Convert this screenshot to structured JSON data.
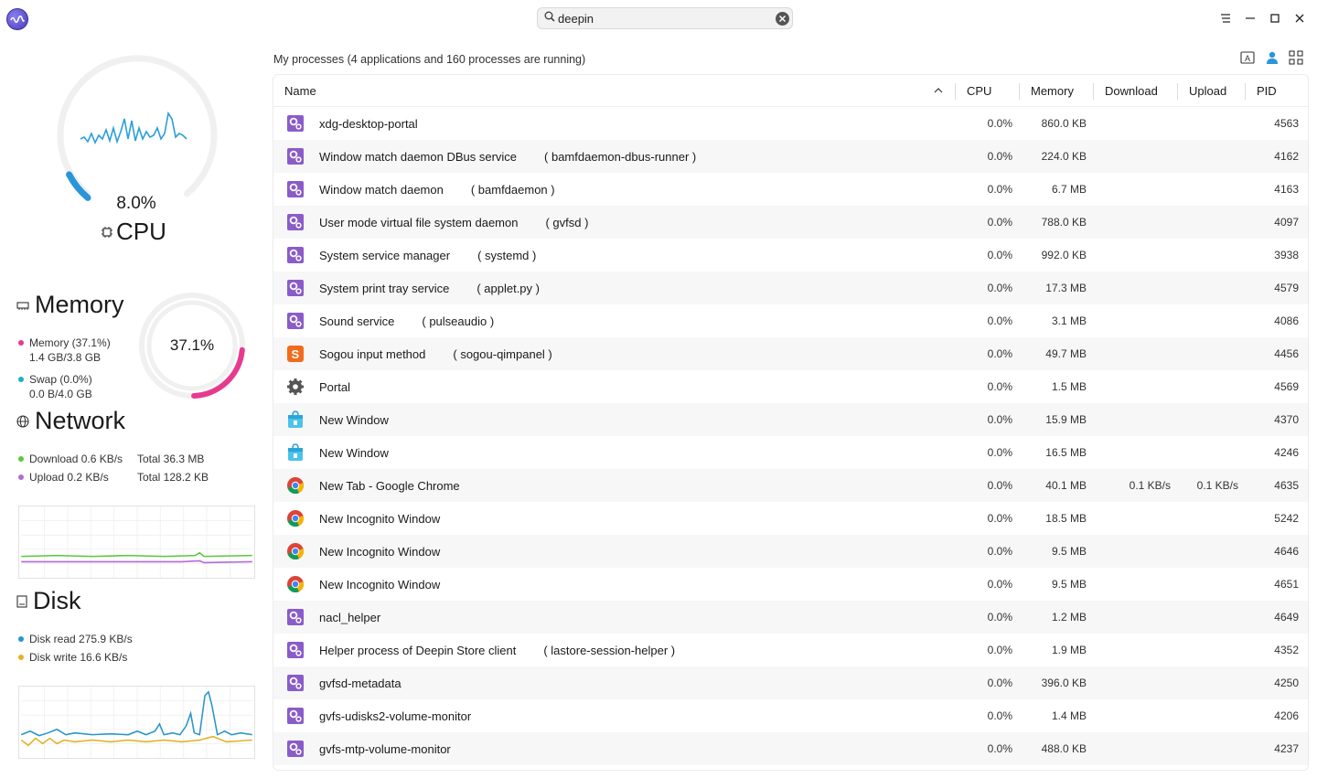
{
  "search": {
    "value": "deepin"
  },
  "cpu": {
    "percent": 8.0,
    "value_label": "8.0%",
    "label": "CPU"
  },
  "memory": {
    "title": "Memory",
    "percent": 37.1,
    "value_label": "37.1%",
    "mem_line": "Memory (37.1%)",
    "mem_detail": "1.4 GB/3.8 GB",
    "swap_line": "Swap (0.0%)",
    "swap_detail": "0.0 B/4.0 GB",
    "mem_color": "#e63a8f",
    "swap_color": "#1eb0c6"
  },
  "network": {
    "title": "Network",
    "download": "Download 0.6 KB/s",
    "download_total": "Total 36.3 MB",
    "upload": "Upload 0.2 KB/s",
    "upload_total": "Total 128.2 KB",
    "download_color": "#5cc83a",
    "upload_color": "#b36ad9"
  },
  "disk": {
    "title": "Disk",
    "read": "Disk read 275.9 KB/s",
    "write": "Disk write 16.6 KB/s",
    "read_color": "#2a95c9",
    "write_color": "#e3b227"
  },
  "process_view": {
    "title": "My processes (4 applications and 160 processes are running)",
    "columns": {
      "name": "Name",
      "cpu": "CPU",
      "memory": "Memory",
      "download": "Download",
      "upload": "Upload",
      "pid": "PID"
    },
    "rows": [
      {
        "name": "xdg-desktop-portal",
        "extra": "",
        "cpu": "0.0%",
        "memory": "860.0 KB",
        "download": "",
        "upload": "",
        "pid": "4563",
        "icon": "gear-process-icon"
      },
      {
        "name": "Window match daemon DBus service",
        "extra": "( bamfdaemon-dbus-runner )",
        "cpu": "0.0%",
        "memory": "224.0 KB",
        "download": "",
        "upload": "",
        "pid": "4162",
        "icon": "gear-process-icon"
      },
      {
        "name": "Window match daemon",
        "extra": "( bamfdaemon )",
        "cpu": "0.0%",
        "memory": "6.7 MB",
        "download": "",
        "upload": "",
        "pid": "4163",
        "icon": "gear-process-icon"
      },
      {
        "name": "User mode virtual file system daemon",
        "extra": "( gvfsd )",
        "cpu": "0.0%",
        "memory": "788.0 KB",
        "download": "",
        "upload": "",
        "pid": "4097",
        "icon": "gear-process-icon"
      },
      {
        "name": "System service manager",
        "extra": "( systemd )",
        "cpu": "0.0%",
        "memory": "992.0 KB",
        "download": "",
        "upload": "",
        "pid": "3938",
        "icon": "gear-process-icon"
      },
      {
        "name": "System print tray service",
        "extra": "( applet.py )",
        "cpu": "0.0%",
        "memory": "17.3 MB",
        "download": "",
        "upload": "",
        "pid": "4579",
        "icon": "gear-process-icon"
      },
      {
        "name": "Sound service",
        "extra": "( pulseaudio )",
        "cpu": "0.0%",
        "memory": "3.1 MB",
        "download": "",
        "upload": "",
        "pid": "4086",
        "icon": "gear-process-icon"
      },
      {
        "name": "Sogou input method",
        "extra": "( sogou-qimpanel )",
        "cpu": "0.0%",
        "memory": "49.7 MB",
        "download": "",
        "upload": "",
        "pid": "4456",
        "icon": "sogou-icon"
      },
      {
        "name": "Portal",
        "extra": "",
        "cpu": "0.0%",
        "memory": "1.5 MB",
        "download": "",
        "upload": "",
        "pid": "4569",
        "icon": "settings-gear-icon"
      },
      {
        "name": "New Window",
        "extra": "",
        "cpu": "0.0%",
        "memory": "15.9 MB",
        "download": "",
        "upload": "",
        "pid": "4370",
        "icon": "store-bag-icon"
      },
      {
        "name": "New Window",
        "extra": "",
        "cpu": "0.0%",
        "memory": "16.5 MB",
        "download": "",
        "upload": "",
        "pid": "4246",
        "icon": "store-bag-icon"
      },
      {
        "name": "New Tab - Google Chrome",
        "extra": "",
        "cpu": "0.0%",
        "memory": "40.1 MB",
        "download": "0.1 KB/s",
        "upload": "0.1 KB/s",
        "pid": "4635",
        "icon": "chrome-icon"
      },
      {
        "name": "New Incognito Window",
        "extra": "",
        "cpu": "0.0%",
        "memory": "18.5 MB",
        "download": "",
        "upload": "",
        "pid": "5242",
        "icon": "chrome-icon"
      },
      {
        "name": "New Incognito Window",
        "extra": "",
        "cpu": "0.0%",
        "memory": "9.5 MB",
        "download": "",
        "upload": "",
        "pid": "4646",
        "icon": "chrome-icon"
      },
      {
        "name": "New Incognito Window",
        "extra": "",
        "cpu": "0.0%",
        "memory": "9.5 MB",
        "download": "",
        "upload": "",
        "pid": "4651",
        "icon": "chrome-icon"
      },
      {
        "name": "nacl_helper",
        "extra": "",
        "cpu": "0.0%",
        "memory": "1.2 MB",
        "download": "",
        "upload": "",
        "pid": "4649",
        "icon": "gear-process-icon"
      },
      {
        "name": "Helper process of Deepin Store client",
        "extra": "( lastore-session-helper )",
        "cpu": "0.0%",
        "memory": "1.9 MB",
        "download": "",
        "upload": "",
        "pid": "4352",
        "icon": "gear-process-icon"
      },
      {
        "name": "gvfsd-metadata",
        "extra": "",
        "cpu": "0.0%",
        "memory": "396.0 KB",
        "download": "",
        "upload": "",
        "pid": "4250",
        "icon": "gear-process-icon"
      },
      {
        "name": "gvfs-udisks2-volume-monitor",
        "extra": "",
        "cpu": "0.0%",
        "memory": "1.4 MB",
        "download": "",
        "upload": "",
        "pid": "4206",
        "icon": "gear-process-icon"
      },
      {
        "name": "gvfs-mtp-volume-monitor",
        "extra": "",
        "cpu": "0.0%",
        "memory": "488.0 KB",
        "download": "",
        "upload": "",
        "pid": "4237",
        "icon": "gear-process-icon"
      }
    ]
  },
  "colors": {
    "accent": "#2a95d9",
    "cpu_wave": "#2a9fd8",
    "process_icon": "#8a5cc9"
  }
}
